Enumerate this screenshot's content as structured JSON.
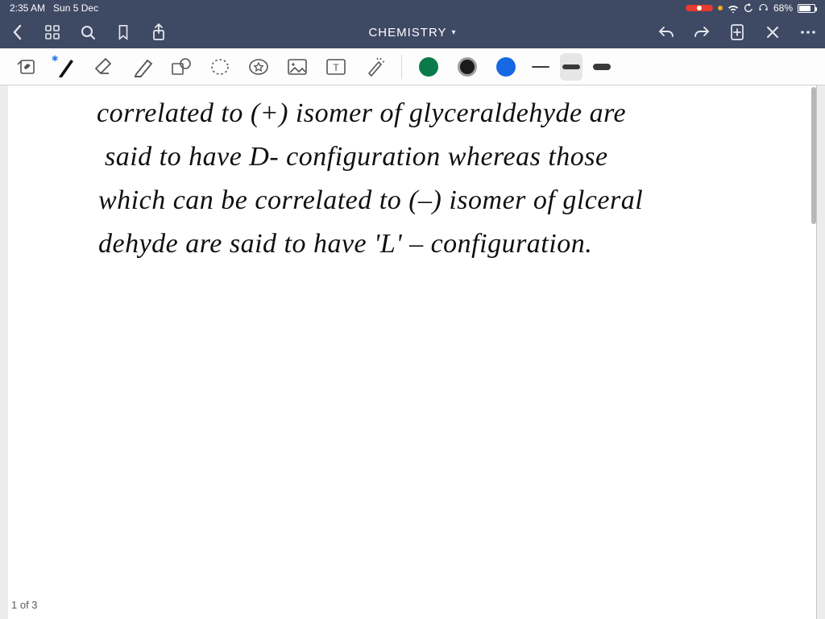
{
  "status": {
    "time": "2:35 AM",
    "date": "Sun 5 Dec",
    "battery_pct": "68%"
  },
  "titlebar": {
    "title": "CHEMISTRY"
  },
  "tools": {
    "readmode": "read-mode",
    "pen": "pen",
    "eraser": "eraser",
    "highlighter": "highlighter",
    "shapes": "shapes",
    "lasso": "lasso",
    "favorites": "favorites",
    "image": "image",
    "textbox": "text",
    "laser": "laser",
    "color_green": "#0b7a4b",
    "color_black": "#1b1b1b",
    "color_blue": "#1668e3"
  },
  "handwriting": {
    "l1": "correlated   to   (+)  isomer    of    glyceraldehyde   are",
    "l2": "said    to    have      D-  configuration    whereas    those",
    "l3": "which    can   be    correlated   to   (–)   isomer   of  glceral",
    "l4": "dehyde    are    said    to    have    'L'  –  configuration."
  },
  "footer": {
    "page_counter": "1 of 3"
  }
}
